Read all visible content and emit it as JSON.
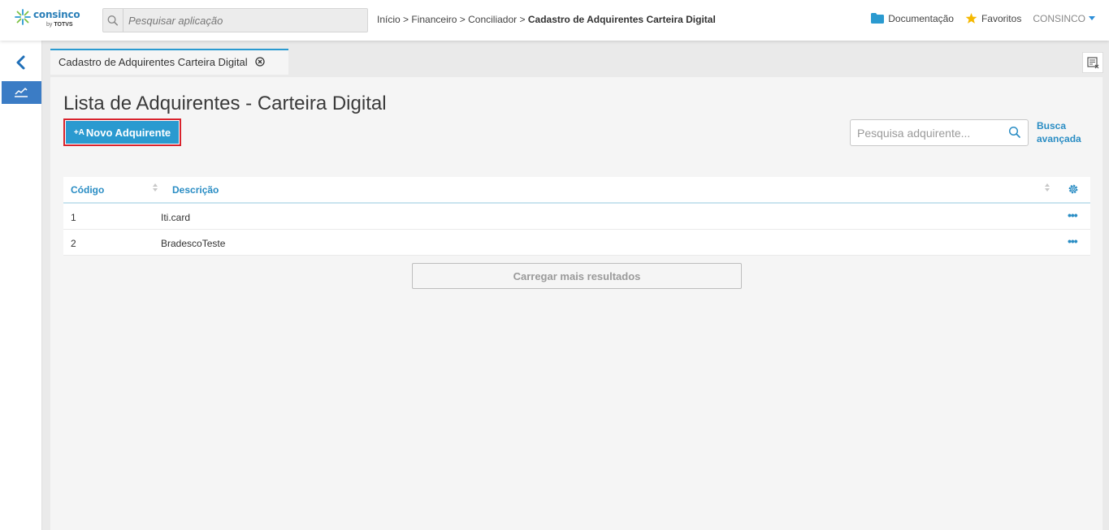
{
  "brand": {
    "name": "consinco",
    "by_prefix": "by",
    "by_company": "TOTVS",
    "color": "#2a7fb8"
  },
  "header": {
    "search_placeholder": "Pesquisar aplicação",
    "breadcrumb": [
      "Início",
      "Financeiro",
      "Conciliador",
      "Cadastro de Adquirentes Carteira Digital"
    ],
    "breadcrumb_sep": ">",
    "links": {
      "documentation": "Documentação",
      "favorites": "Favoritos",
      "user": "CONSINCO"
    },
    "icons": {
      "search": "search-icon",
      "documentation": "folder-icon",
      "favorites": "star-icon",
      "user_menu": "caret-down-icon"
    }
  },
  "sidebar": {
    "collapse_icon": "chevron-left-icon",
    "items": [
      {
        "icon": "chart-line-icon",
        "active": true
      }
    ]
  },
  "tabs": [
    {
      "label": "Cadastro de Adquirentes Carteira Digital",
      "active": true,
      "close_icon": "close-circle-icon"
    }
  ],
  "tab_menu_icon": "list-close-icon",
  "main": {
    "title": "Lista de Adquirentes - Carteira Digital",
    "new_button": {
      "prefix": "+A",
      "label": "Novo Adquirente"
    },
    "search": {
      "placeholder": "Pesquisa adquirente...",
      "icon": "search-icon"
    },
    "advanced_search": [
      "Busca",
      "avançada"
    ],
    "table": {
      "columns": [
        "Código",
        "Descrição"
      ],
      "settings_icon": "gear-icon",
      "rows": [
        {
          "codigo": "1",
          "descricao": "Iti.card",
          "menu": "•••"
        },
        {
          "codigo": "2",
          "descricao": "BradescoTeste",
          "menu": "•••"
        }
      ]
    },
    "load_more_label": "Carregar mais resultados"
  },
  "colors": {
    "accent": "#2a9ad0",
    "link": "#2a8dc4",
    "highlight_border": "#d9232d",
    "sidebar_active": "#3b7cc5",
    "star": "#f5b800"
  }
}
